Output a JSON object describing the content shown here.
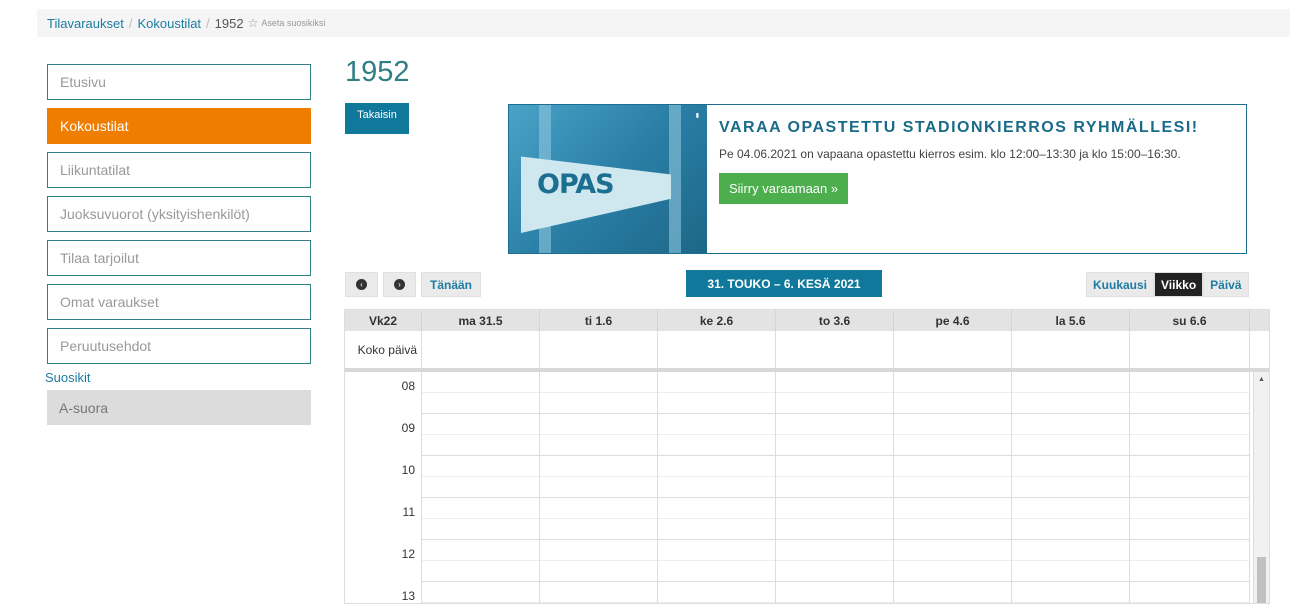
{
  "breadcrumb": {
    "items": [
      "Tilavaraukset",
      "Kokoustilat"
    ],
    "current": "1952",
    "favorite_label": "Aseta suosikiksi"
  },
  "sidebar": {
    "items": [
      {
        "label": "Etusivu",
        "active": false
      },
      {
        "label": "Kokoustilat",
        "active": true
      },
      {
        "label": "Liikuntatilat",
        "active": false
      },
      {
        "label": "Juoksuvuorot (yksityishenkilöt)",
        "active": false
      },
      {
        "label": "Tilaa tarjoilut",
        "active": false
      },
      {
        "label": "Omat varaukset",
        "active": false
      },
      {
        "label": "Peruutusehdot",
        "active": false
      }
    ],
    "favorites_label": "Suosikit",
    "favorites": [
      "A-suora"
    ]
  },
  "page": {
    "title": "1952",
    "back_label": "Takaisin"
  },
  "banner": {
    "image_text": "OPAS",
    "heading": "VARAA OPASTETTU STADIONKIERROS RYHMÄLLESI!",
    "body": "Pe 04.06.2021 on vapaana opastettu kierros esim. klo 12:00–13:30 ja klo 15:00–16:30.",
    "cta_label": "Siirry varaamaan »"
  },
  "calendar": {
    "today_label": "Tänään",
    "range_title": "31. TOUKO – 6. KESÄ 2021",
    "views": [
      {
        "label": "Kuukausi",
        "active": false
      },
      {
        "label": "Viikko",
        "active": true
      },
      {
        "label": "Päivä",
        "active": false
      }
    ],
    "week_label": "Vk22",
    "days": [
      "ma 31.5",
      "ti 1.6",
      "ke 2.6",
      "to 3.6",
      "pe 4.6",
      "la 5.6",
      "su 6.6"
    ],
    "allday_label": "Koko päivä",
    "hours": [
      "08",
      "09",
      "10",
      "11",
      "12",
      "13"
    ]
  },
  "colors": {
    "accent": "#ef7d00",
    "primary": "#10799b",
    "success": "#4cae4c",
    "teal": "#2f7f85"
  }
}
